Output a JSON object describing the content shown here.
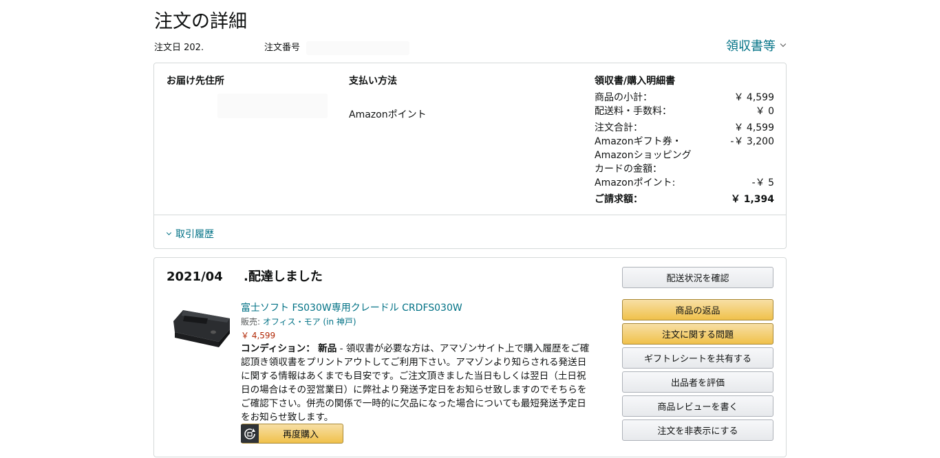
{
  "page": {
    "title": "注文の詳細",
    "order_date_label": "注文日 202.",
    "order_number_label": "注文番号",
    "receipts_link": "領収書等"
  },
  "summary": {
    "shipping_address_heading": "お届け先住所",
    "payment_heading": "支払い方法",
    "payment_method": "Amazonポイント",
    "receipt_heading": "領収書/購入明細書",
    "rows": [
      {
        "label": "商品の小計：",
        "value": "￥ 4,599"
      },
      {
        "label": "配送料・手数料：",
        "value": "￥ 0"
      },
      {
        "label": "注文合計：",
        "value": "￥ 4,599"
      },
      {
        "label": "Amazonギフト券・\nAmazonショッピング\nカードの金額：",
        "value": "-￥ 3,200"
      },
      {
        "label": "Amazonポイント:",
        "value": "-￥ 5"
      }
    ],
    "total": {
      "label": "ご請求額：",
      "value": "￥ 1,394"
    },
    "history_link": "取引履歴"
  },
  "shipment": {
    "date": "2021/04",
    "status": ".配達しました",
    "item": {
      "title": "富士ソフト FS030W専用クレードル CRDFS030W",
      "seller_prefix": "販売: ",
      "seller_name": "オフィス・モア (in 神戸)",
      "price": "￥ 4,599",
      "condition_label": "コンディション：",
      "condition_value": "新品",
      "condition_text": " - 領収書が必要な方は、アマゾンサイト上で購入履歴をご確\n認頂き領収書をプリントアウトしてご利用下さい。アマゾンより知らされる発送日\nに関する情報はあくまでも目安です。ご注文頂きました当日もしくは翌日（土日祝\n日の場合はその翌営業日）に弊社より発送予定日をお知らせ致しますのでそちらを\nご確認下さい。併売の関係で一時的に欠品になった場合についても最短発送予定日\nをお知らせ致します。",
      "rebuy_label": "再度購入"
    },
    "buttons": [
      {
        "label": "配送状況を確認",
        "style": "gray"
      },
      {
        "label": "商品の返品",
        "style": "yellow"
      },
      {
        "label": "注文に関する問題",
        "style": "yellow"
      },
      {
        "label": "ギフトレシートを共有する",
        "style": "gray"
      },
      {
        "label": "出品者を評価",
        "style": "gray"
      },
      {
        "label": "商品レビューを書く",
        "style": "gray"
      },
      {
        "label": "注文を非表示にする",
        "style": "gray"
      }
    ]
  },
  "colors": {
    "link": "#007185",
    "price": "#b12704",
    "primary_button": "#f0c14b",
    "border": "#d5d9d9"
  }
}
